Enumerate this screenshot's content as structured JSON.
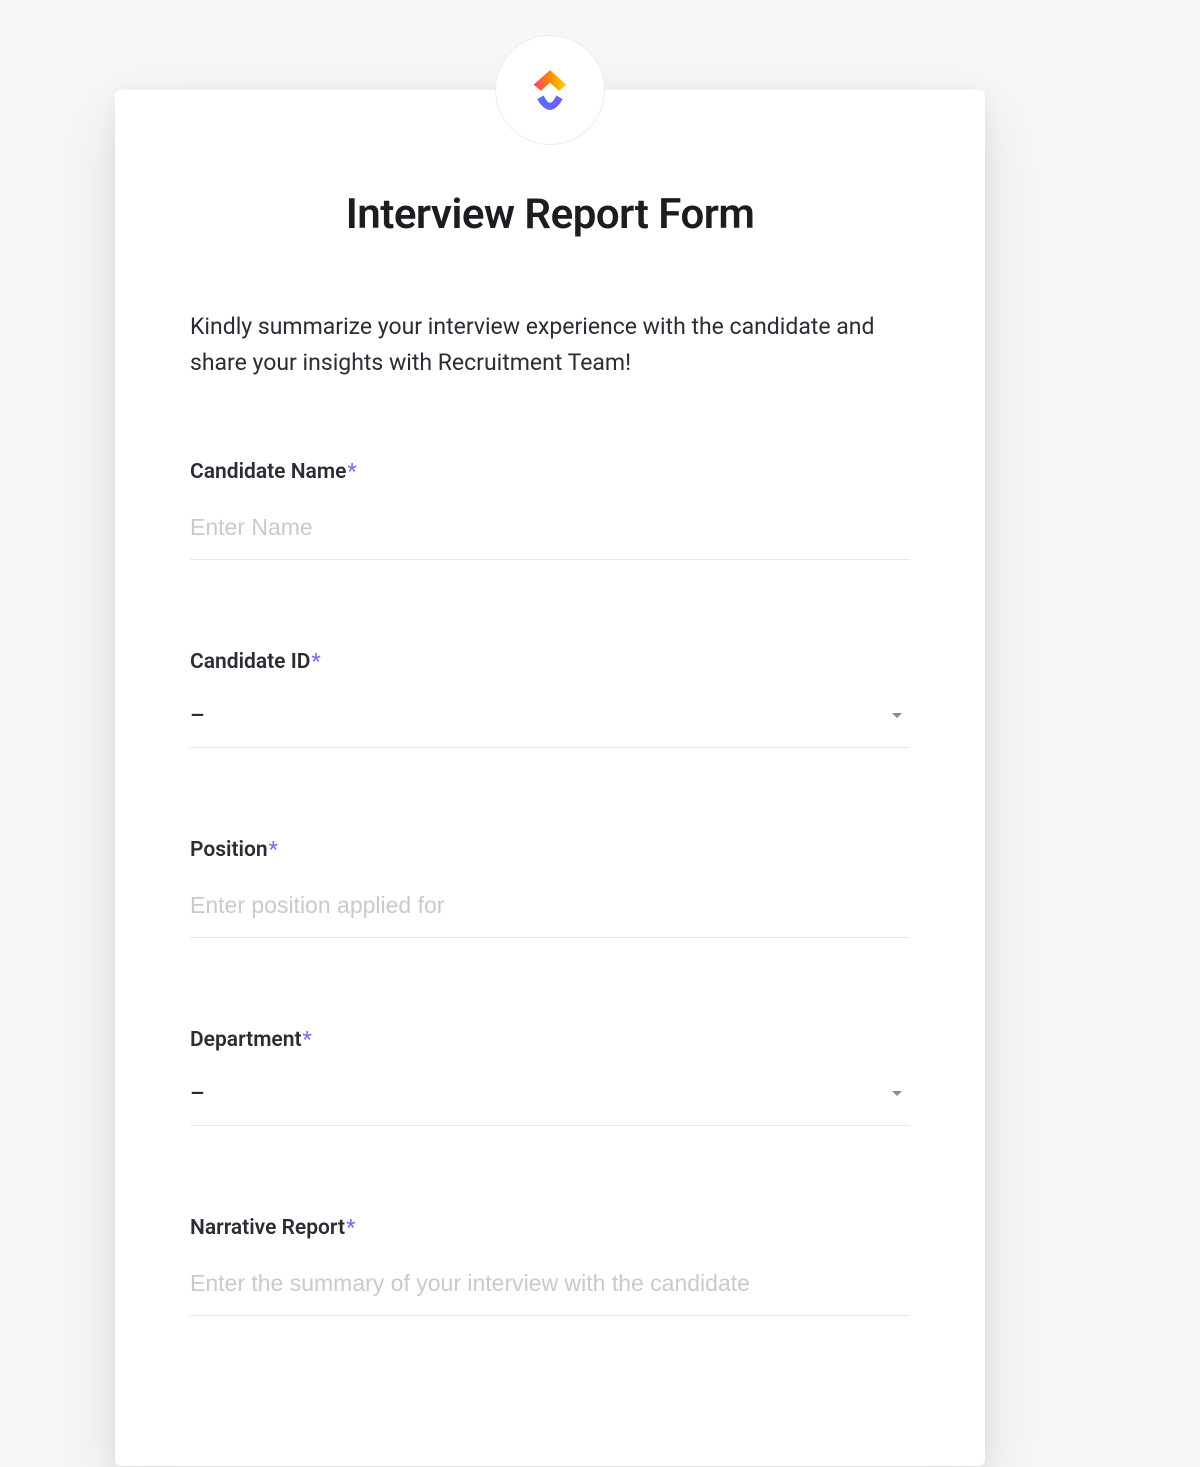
{
  "header": {
    "title": "Interview Report Form",
    "description": "Kindly summarize your interview experience with the candidate and share your insights with Recruitment Team!"
  },
  "fields": {
    "candidate_name": {
      "label": "Candidate Name",
      "required_marker": "*",
      "placeholder": "Enter Name",
      "value": ""
    },
    "candidate_id": {
      "label": "Candidate ID",
      "required_marker": "*",
      "selected": "–"
    },
    "position": {
      "label": "Position",
      "required_marker": "*",
      "placeholder": "Enter position applied for",
      "value": ""
    },
    "department": {
      "label": "Department",
      "required_marker": "*",
      "selected": "–"
    },
    "narrative_report": {
      "label": "Narrative Report",
      "required_marker": "*",
      "placeholder": "Enter the summary of your interview with the candidate",
      "value": ""
    }
  }
}
